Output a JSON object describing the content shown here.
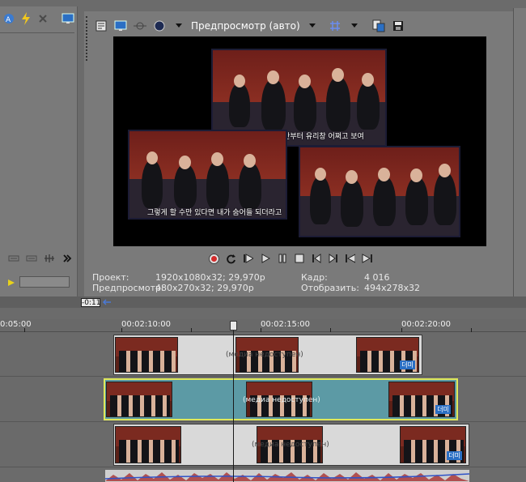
{
  "preview_toolbar": {
    "mode_label": "Предпросмотр (авто)"
  },
  "preview_frame": {
    "subtitle_top": "근데 이게 순간부터 유리창 어쩌고 보여",
    "subtitle_left": "그렇게 할 수만 있다면 내가 숨어들 되더라고"
  },
  "project_info": {
    "project_label": "Проект:",
    "project_value": "1920x1080x32; 29,970p",
    "preview_label": "Предпросмотр:",
    "preview_value": "480x270x32; 29,970p",
    "frame_label": "Кадр:",
    "frame_value": "4 016",
    "display_label": "Отобразить:",
    "display_value": "494x278x32"
  },
  "timeline": {
    "cursor_time": "-0:11",
    "ruler_labels": [
      "0:05:00",
      "00:02:10:00",
      "00:02:15:00",
      "00:02:20:00"
    ],
    "media_unavailable": "(медиа недоступен)",
    "clip_badge": "더미"
  },
  "colors": {
    "selected_clip": "#5c9aa5",
    "selected_border": "#dfe85a",
    "record_red": "#d42b2b"
  }
}
